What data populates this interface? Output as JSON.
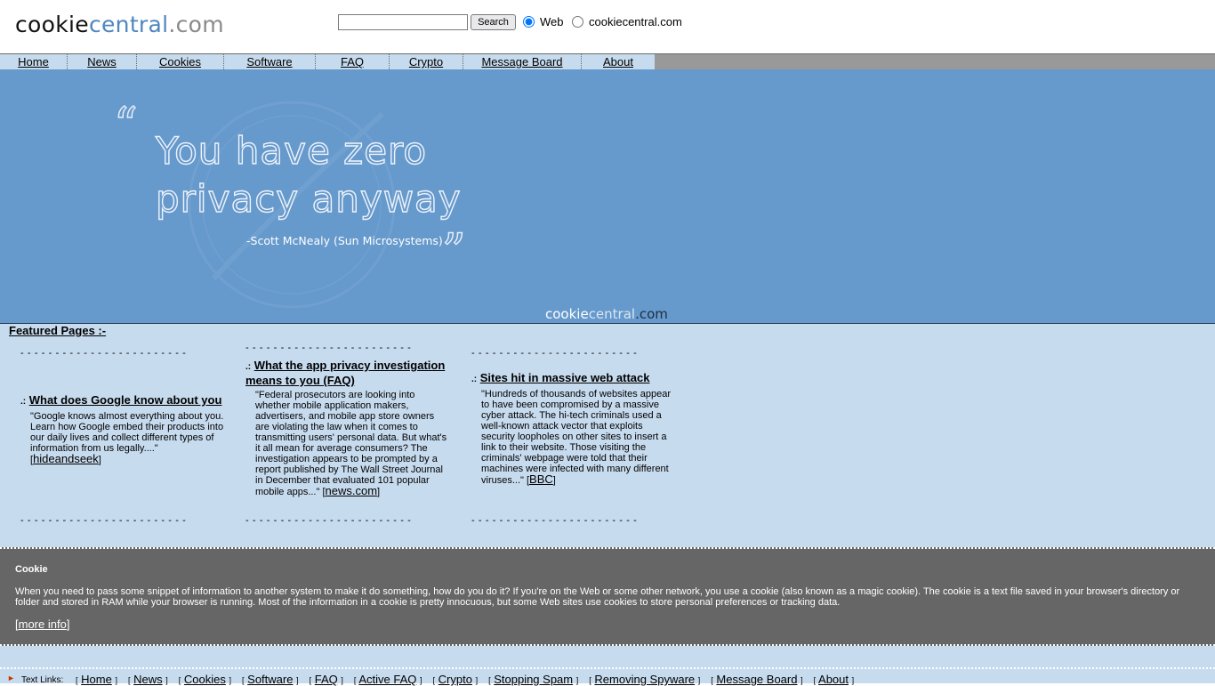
{
  "header": {
    "logo": {
      "part1": "cookie",
      "part2": "central",
      "part3": ".com"
    },
    "search": {
      "value": "",
      "button_label": "Search"
    },
    "radio_web_label": "Web",
    "radio_site_label": "cookiecentral.com"
  },
  "nav": {
    "items": [
      "Home",
      "News",
      "Cookies",
      "Software",
      "FAQ",
      "Crypto",
      "Message Board",
      "About"
    ]
  },
  "banner": {
    "open_quote": "“",
    "line1": "You have zero",
    "line2": "privacy anyway",
    "attribution": "-Scott McNealy (Sun Microsystems)",
    "close_quote": "”",
    "watermark": {
      "part1": "cookie",
      "part2": "central",
      "part3": ".com"
    }
  },
  "featured": {
    "heading": "Featured Pages :-",
    "dashes": "- - - - - - - - - - - - - - - - - - - - - - - -",
    "bullet": ".:",
    "items": [
      {
        "title": "What does Google know about you",
        "body": "\"Google knows almost everything about you. Learn how Google embed their products into our daily lives and collect different types of information from us legally....\"",
        "source": "hideandseek"
      },
      {
        "title": "What the app privacy investigation means to you (FAQ)",
        "body": "\"Federal prosecutors are looking into whether mobile application makers, advertisers, and mobile app store owners are violating the law when it comes to transmitting users' personal data. But what's it all mean for average consumers? The investigation appears to be prompted by a report published by The Wall Street Journal in December that evaluated 101 popular mobile apps...\"",
        "source": "news.com"
      },
      {
        "title": "Sites hit in massive web attack",
        "body": "\"Hundreds of thousands of websites appear to have been compromised by a massive cyber attack. The hi-tech criminals used a well-known attack vector that exploits security loopholes on other sites to insert a link to their website. Those visiting the criminals' webpage were told that their machines were infected with many different viruses...\"",
        "source": "BBC"
      }
    ]
  },
  "cookie_box": {
    "title": "Cookie",
    "text": "When you need to pass some snippet of information to another system to make it do something, how do you do it? If you're on the Web or some other network, you use a cookie (also known as a magic cookie). The cookie is a text file saved in your browser's directory or folder and stored in RAM while your browser is running. Most of the information in a cookie is pretty innocuous, but some Web sites use cookies to store personal preferences or tracking data.",
    "more_link": "more info"
  },
  "footer": {
    "arrow": "►",
    "label": "Text Links:",
    "links": [
      "Home",
      "News",
      "Cookies",
      "Software",
      "FAQ",
      "Active FAQ",
      "Crypto",
      "Stopping Spam",
      "Removing Spyware",
      "Message Board",
      "About"
    ]
  },
  "colors": {
    "banner_bg": "#6699cc",
    "light_band": "#c7dbee",
    "nav_bar": "#999999",
    "cookie_box_bg": "#666666",
    "logo_blue": "#4f86bf",
    "footer_arrow": "#cc3300"
  }
}
